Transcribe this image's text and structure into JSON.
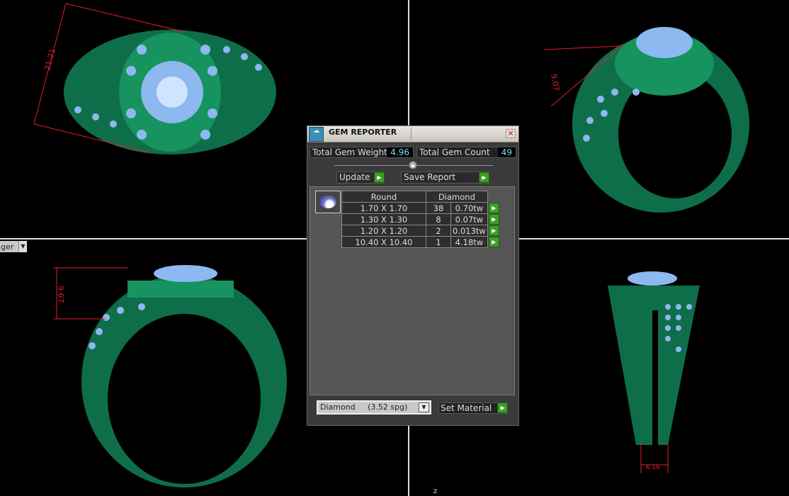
{
  "viewports": {
    "dims": {
      "top_left": "21.21",
      "top_right": "9.07",
      "bottom_left": "9.07",
      "bottom_right": "6.16"
    },
    "combo_label": "ger",
    "axis_label": "z"
  },
  "dialog": {
    "title": "GEM REPORTER",
    "close": "✕",
    "total_weight_label": "Total Gem Weight",
    "total_weight": "4.96",
    "total_count_label": "Total Gem Count",
    "total_count": "49",
    "update_label": "Update",
    "save_report_label": "Save Report",
    "table": {
      "headers": [
        "Round",
        "Diamond"
      ],
      "rows": [
        {
          "size": "1.70 X 1.70",
          "count": "38",
          "weight": "0.70tw"
        },
        {
          "size": "1.30 X 1.30",
          "count": "8",
          "weight": "0.07tw"
        },
        {
          "size": "1.20 X 1.20",
          "count": "2",
          "weight": "0.013tw"
        },
        {
          "size": "10.40 X 10.40",
          "count": "1",
          "weight": "4.18tw"
        }
      ]
    },
    "material": "Diamond     (3.52 spg)",
    "set_material_label": "Set Material"
  },
  "colors": {
    "ring": "#0f7a52",
    "gem": "#8db8f0",
    "dim": "#e0202a"
  }
}
